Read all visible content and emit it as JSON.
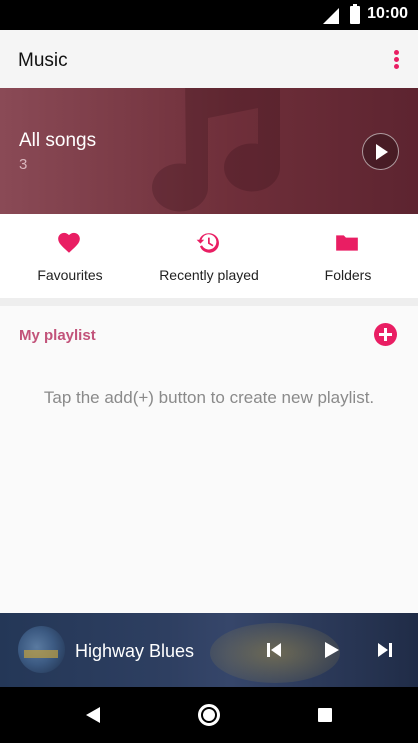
{
  "status_bar": {
    "time": "10:00"
  },
  "app_bar": {
    "title": "Music"
  },
  "hero": {
    "title": "All songs",
    "count": "3"
  },
  "quick_access": [
    {
      "label": "Favourites",
      "icon": "heart-icon"
    },
    {
      "label": "Recently played",
      "icon": "history-icon"
    },
    {
      "label": "Folders",
      "icon": "folder-icon"
    }
  ],
  "playlist": {
    "title": "My playlist",
    "empty_message": "Tap the add(+) button to create new playlist."
  },
  "mini_player": {
    "track_title": "Highway Blues"
  },
  "colors": {
    "accent": "#e91e63",
    "section_title": "#c2537a",
    "hero": "#6f2f3a"
  }
}
